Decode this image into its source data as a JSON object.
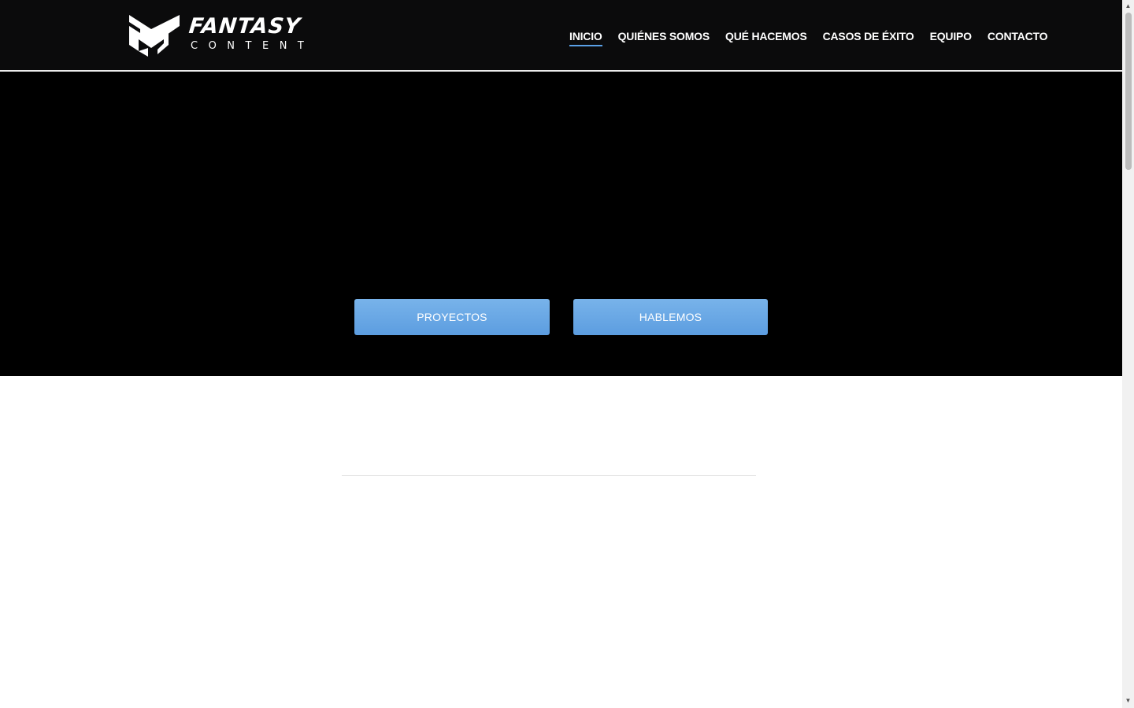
{
  "brand": {
    "name": "FANTASY",
    "tagline": "CONTENT",
    "logo_icon": "fantasy-content-mark-icon"
  },
  "nav": {
    "items": [
      {
        "label": "INICIO",
        "active": true
      },
      {
        "label": "QUIÉNES SOMOS",
        "active": false
      },
      {
        "label": "QUÉ HACEMOS",
        "active": false
      },
      {
        "label": "CASOS DE ÉXITO",
        "active": false
      },
      {
        "label": "EQUIPO",
        "active": false
      },
      {
        "label": "CONTACTO",
        "active": false
      }
    ]
  },
  "hero": {
    "primary_button": "PROYECTOS",
    "secondary_button": "HABLEMOS"
  },
  "colors": {
    "header_bg": "#0b0b0c",
    "hero_bg": "#000000",
    "accent": "#5aa0e6",
    "button": "#6aa8e6"
  },
  "scrollbar": {
    "up_icon": "▲",
    "down_icon": "▼"
  }
}
